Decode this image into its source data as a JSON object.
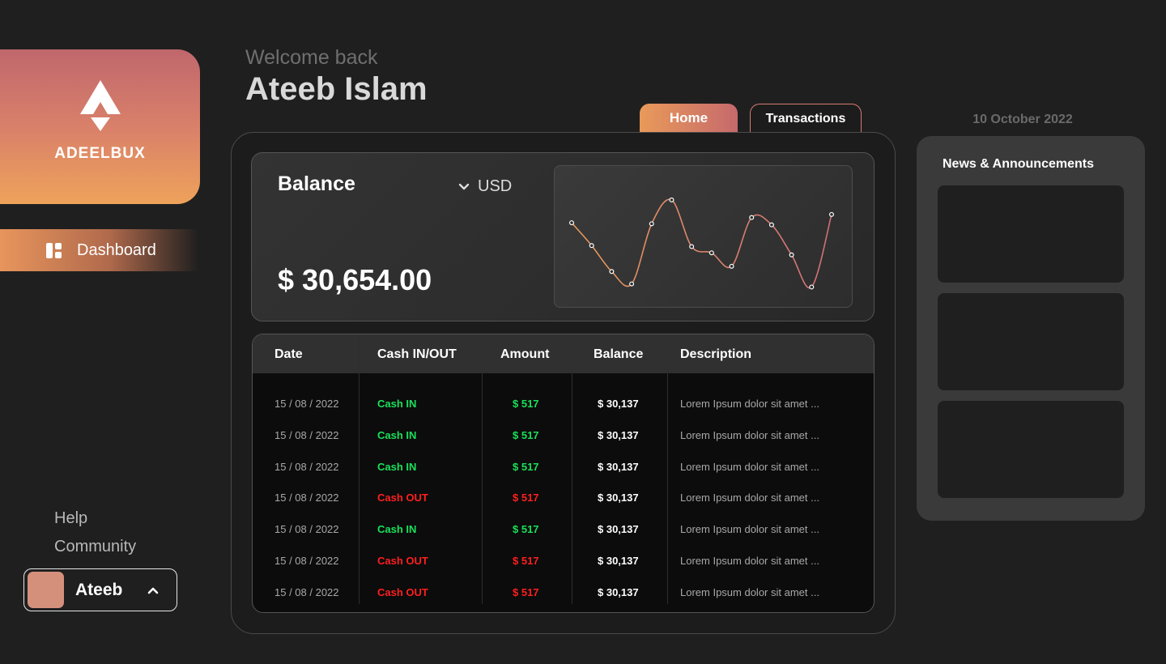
{
  "brand": {
    "name": "ADEELBUX",
    "logo_icon": "adeelbux-logo-icon"
  },
  "sidebar": {
    "items": [
      {
        "label": "Dashboard",
        "icon": "dashboard-icon"
      }
    ],
    "help_label": "Help",
    "community_label": "Community",
    "user": {
      "name": "Ateeb",
      "icon": "chevron-up-icon"
    }
  },
  "header": {
    "welcome": "Welcome back",
    "name": "Ateeb Islam"
  },
  "tabs": [
    {
      "label": "Home",
      "active": true
    },
    {
      "label": "Transactions",
      "active": false
    }
  ],
  "balance": {
    "title": "Balance",
    "currency": "USD",
    "amount": "$ 30,654.00",
    "sparkline": [
      0.64,
      0.42,
      0.17,
      0.05,
      0.63,
      0.86,
      0.41,
      0.35,
      0.22,
      0.69,
      0.62,
      0.33,
      0.02,
      0.72
    ]
  },
  "table": {
    "headers": [
      "Date",
      "Cash IN/OUT",
      "Amount",
      "Balance",
      "Description"
    ],
    "rows": [
      {
        "date": "15 / 08 / 2022",
        "type": "Cash IN",
        "direction": "in",
        "amount": "$ 517",
        "balance": "$ 30,137",
        "description": "Lorem Ipsum dolor sit amet ..."
      },
      {
        "date": "15 / 08 / 2022",
        "type": "Cash IN",
        "direction": "in",
        "amount": "$ 517",
        "balance": "$ 30,137",
        "description": "Lorem Ipsum dolor sit amet ..."
      },
      {
        "date": "15 / 08 / 2022",
        "type": "Cash IN",
        "direction": "in",
        "amount": "$ 517",
        "balance": "$ 30,137",
        "description": "Lorem Ipsum dolor sit amet ..."
      },
      {
        "date": "15 / 08 / 2022",
        "type": "Cash OUT",
        "direction": "out",
        "amount": "$ 517",
        "balance": "$ 30,137",
        "description": "Lorem Ipsum dolor sit amet ..."
      },
      {
        "date": "15 / 08 / 2022",
        "type": "Cash IN",
        "direction": "in",
        "amount": "$ 517",
        "balance": "$ 30,137",
        "description": "Lorem Ipsum dolor sit amet ..."
      },
      {
        "date": "15 / 08 / 2022",
        "type": "Cash OUT",
        "direction": "out",
        "amount": "$ 517",
        "balance": "$ 30,137",
        "description": "Lorem Ipsum dolor sit amet ..."
      },
      {
        "date": "15 / 08 / 2022",
        "type": "Cash OUT",
        "direction": "out",
        "amount": "$ 517",
        "balance": "$ 30,137",
        "description": "Lorem Ipsum dolor sit amet ..."
      }
    ]
  },
  "date": "10 October 2022",
  "news": {
    "title": "News & Announcements",
    "item_count": 3
  },
  "colors": {
    "background": "#1f1f1f",
    "accent_orange": "#eea25a",
    "accent_pink": "#c0676d",
    "cash_in": "#19e15a",
    "cash_out": "#ff1f1f"
  }
}
